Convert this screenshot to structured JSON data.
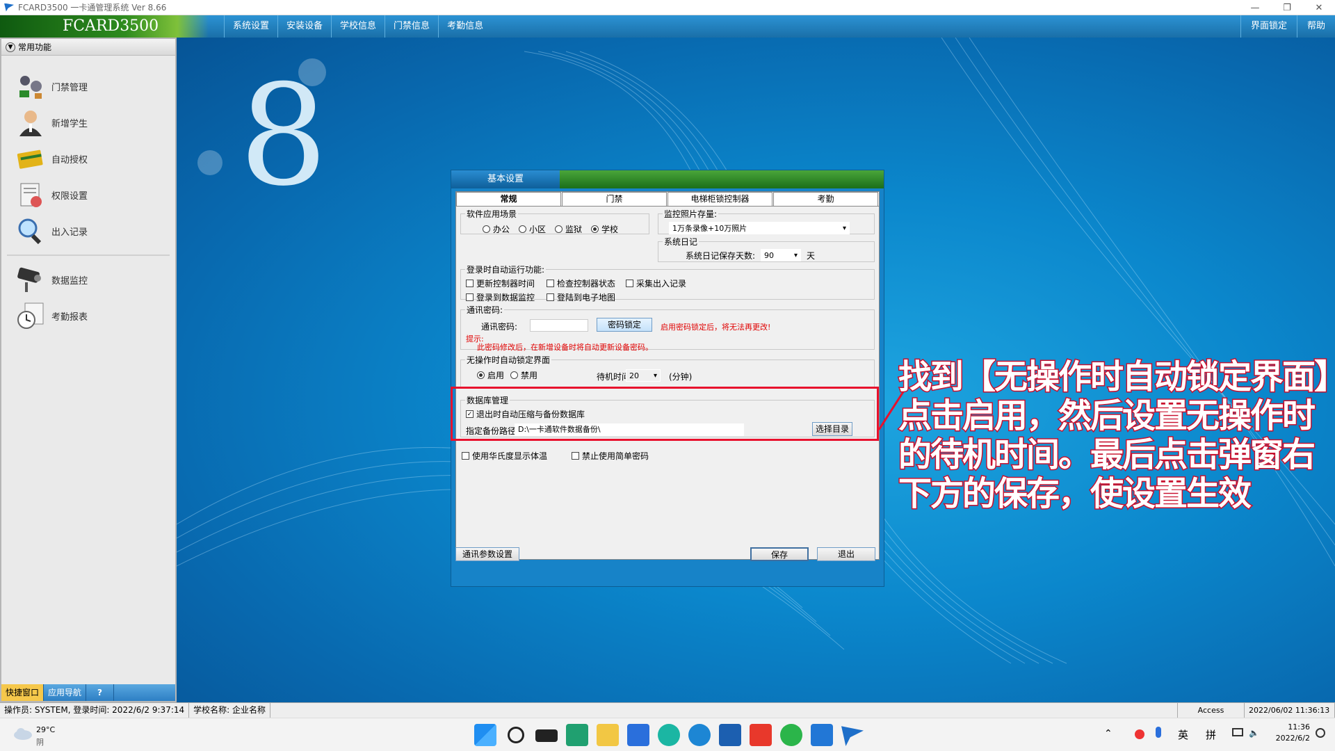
{
  "window": {
    "title": "FCARD3500 一卡通管理系统  Ver 8.66",
    "controls": [
      "—",
      "❐",
      "✕"
    ]
  },
  "brand": "FCARD3500",
  "menu": [
    "系统设置",
    "安装设备",
    "学校信息",
    "门禁信息",
    "考勤信息"
  ],
  "menu_right": [
    "界面锁定",
    "帮助"
  ],
  "sidebar": {
    "header": "常用功能",
    "items": [
      {
        "label": "门禁管理",
        "icon": "door-control-icon"
      },
      {
        "label": "新增学生",
        "icon": "person-icon"
      },
      {
        "label": "自动授权",
        "icon": "card-icon"
      },
      {
        "label": "权限设置",
        "icon": "permission-icon"
      },
      {
        "label": "出入记录",
        "icon": "magnifier-icon"
      }
    ],
    "items2": [
      {
        "label": "数据监控",
        "icon": "camera-icon"
      },
      {
        "label": "考勤报表",
        "icon": "clock-icon"
      }
    ],
    "bottom_tabs": [
      "快捷窗口",
      "应用导航",
      "?"
    ]
  },
  "dialog": {
    "title": "基本设置",
    "tabs": [
      "常规",
      "门禁",
      "电梯柜锁控制器",
      "考勤"
    ],
    "scene": {
      "legend": "软件应用场景",
      "options": [
        "办公",
        "小区",
        "监狱",
        "学校"
      ],
      "selected": "学校"
    },
    "photo": {
      "legend": "监控照片存量:",
      "value": "1万条录像+10万照片"
    },
    "log": {
      "legend": "系统日记",
      "label": "系统日记保存天数:",
      "value": "90",
      "unit": "天"
    },
    "auto": {
      "legend": "登录时自动运行功能:",
      "items": [
        "更新控制器时间",
        "检查控制器状态",
        "采集出入记录",
        "登录到数据监控",
        "登陆到电子地图"
      ]
    },
    "password": {
      "legend": "通讯密码:",
      "label": "通讯密码:",
      "button": "密码锁定",
      "warn": "启用密码锁定后，将无法再更改!",
      "hint_label": "提示:",
      "hint": "此密码修改后，在新增设备时将自动更新设备密码。"
    },
    "lock": {
      "legend": "无操作时自动锁定界面",
      "enable": "启用",
      "disable": "禁用",
      "wait_label": "待机时间",
      "wait_value": "20",
      "unit": "(分钟)"
    },
    "db": {
      "legend": "数据库管理",
      "auto_backup": "退出时自动压缩与备份数据库",
      "path_label": "指定备份路径:",
      "path_value": "D:\\一卡通软件数据备份\\",
      "choose": "选择目录"
    },
    "fahrenheit": "使用华氏度显示体温",
    "no_simple_pwd": "禁止使用简单密码",
    "comm_btn": "通讯参数设置",
    "save_btn": "保存",
    "exit_btn": "退出"
  },
  "callout": "找到【无操作时自动锁定界面】点击启用，然后设置无操作时的待机时间。最后点击弹窗右下方的保存，使设置生效",
  "status": {
    "operator": "操作员: SYSTEM, 登录时间: 2022/6/2 9:37:14",
    "school": "学校名称: 企业名称",
    "db": "Access",
    "datetime": "2022/06/02 11:36:13"
  },
  "taskbar": {
    "temp": "29°C",
    "weather": "阴",
    "time": "11:36",
    "date": "2022/6/2",
    "ime1": "英",
    "ime2": "拼"
  },
  "colors": {
    "desktop": "#0b87cc",
    "highlight": "#e8112d",
    "menubar": "#1a6fa8"
  }
}
